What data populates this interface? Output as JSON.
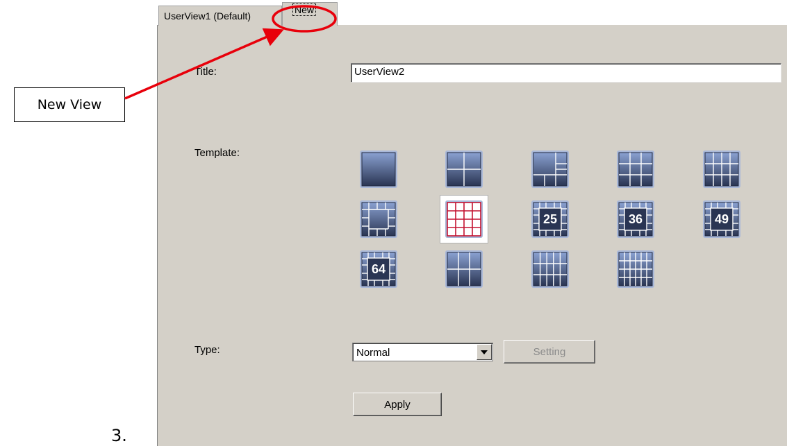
{
  "tabs": {
    "default_label": "UserView1 (Default)",
    "new_label": "New"
  },
  "form": {
    "title_label": "Title:",
    "title_value": "UserView2",
    "template_label": "Template:",
    "type_label": "Type:",
    "type_value": "Normal",
    "setting_label": "Setting",
    "apply_label": "Apply"
  },
  "templates": [
    {
      "icon": "layout-1x1-icon"
    },
    {
      "icon": "layout-2x2-icon"
    },
    {
      "icon": "layout-1plus5-icon"
    },
    {
      "icon": "layout-3x3-icon"
    },
    {
      "icon": "layout-4x3-icon"
    },
    {
      "icon": "layout-1plus12-icon"
    },
    {
      "icon": "layout-4x4-icon",
      "selected": true
    },
    {
      "icon": "layout-25-icon",
      "number": "25"
    },
    {
      "icon": "layout-36-icon",
      "number": "36"
    },
    {
      "icon": "layout-49-icon",
      "number": "49"
    },
    {
      "icon": "layout-64-icon",
      "number": "64"
    },
    {
      "icon": "layout-3x2-icon"
    },
    {
      "icon": "layout-5x3-icon"
    },
    {
      "icon": "layout-6x4-icon"
    }
  ],
  "annotation": {
    "callout_text": "New View",
    "step_number": "3.",
    "color": "#e8000b"
  },
  "colors": {
    "panel": "#d4d0c8",
    "icon_dark": "#2a3553",
    "icon_light": "#8aa1d1",
    "selected_grid": "#c41230"
  }
}
